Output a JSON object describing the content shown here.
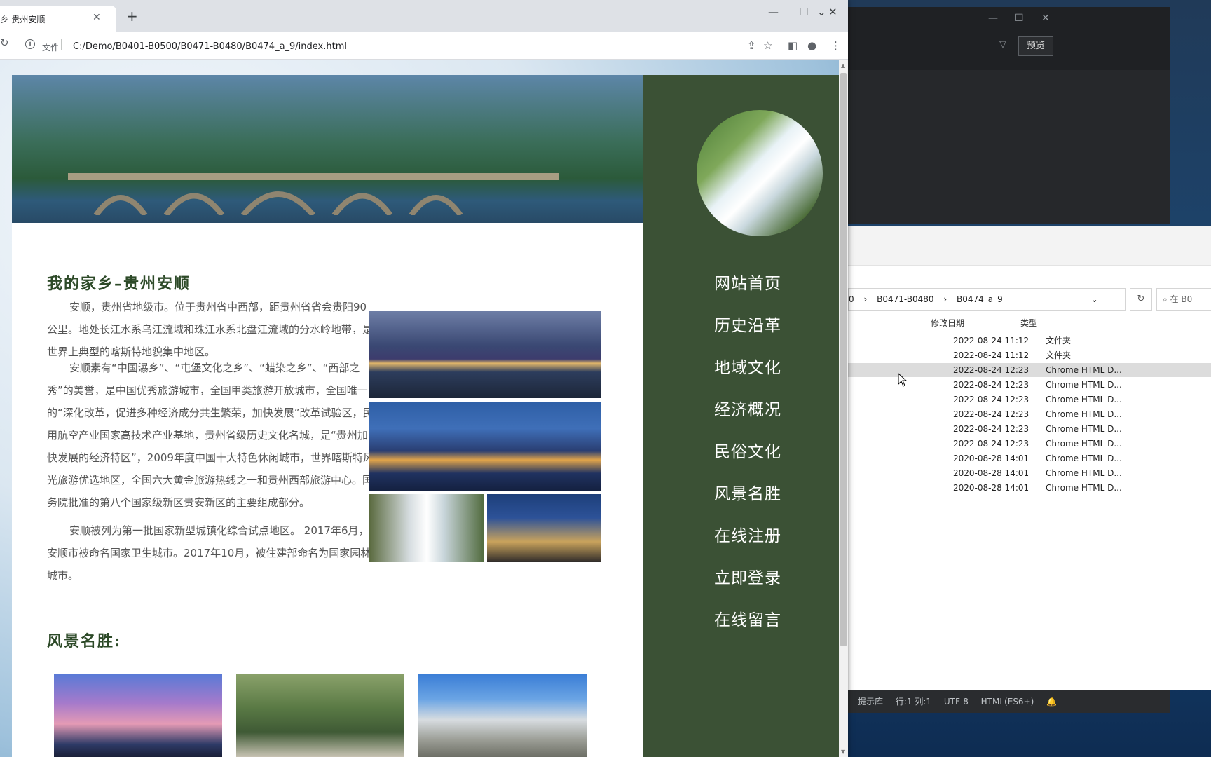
{
  "browser": {
    "tab_title": "乡-贵州安顺",
    "url_scheme_label": "文件",
    "url": "C:/Demo/B0401-B0500/B0471-B0480/B0474_a_9/index.html"
  },
  "page": {
    "title": "我的家乡–贵州安顺",
    "paragraphs": [
      "安顺，贵州省地级市。位于贵州省中西部，距贵州省省会贵阳90公里。地处长江水系乌江流域和珠江水系北盘江流域的分水岭地带，是世界上典型的喀斯特地貌集中地区。",
      "安顺素有“中国瀑乡”、“屯堡文化之乡”、“蜡染之乡”、“西部之秀”的美誉，是中国优秀旅游城市，全国甲类旅游开放城市，全国唯一的“深化改革，促进多种经济成分共生繁荣，加快发展”改革试验区，民用航空产业国家高技术产业基地，贵州省级历史文化名城，是“贵州加快发展的经济特区”，2009年度中国十大特色休闲城市，世界喀斯特风光旅游优选地区，全国六大黄金旅游热线之一和贵州西部旅游中心。国务院批准的第八个国家级新区贵安新区的主要组成部分。",
      "安顺被列为第一批国家新型城镇化综合试点地区。 2017年6月，安顺市被命名国家卫生城市。2017年10月，被住建部命名为国家园林城市。"
    ],
    "subtitle": "风景名胜:",
    "nav": [
      "网站首页",
      "历史沿革",
      "地域文化",
      "经济概况",
      "民俗文化",
      "风景名胜",
      "在线注册",
      "立即登录",
      "在线留言"
    ]
  },
  "editor": {
    "preview_label": "预览",
    "status": [
      "提示库",
      "行:1 列:1",
      "UTF-8",
      "HTML(ES6+)"
    ]
  },
  "explorer": {
    "breadcrumb": [
      "0",
      "B0471-B0480",
      "B0474_a_9"
    ],
    "search_placeholder": "在 B0",
    "columns": [
      "修改日期",
      "类型"
    ],
    "rows": [
      {
        "date": "2022-08-24 11:12",
        "type": "文件夹"
      },
      {
        "date": "2022-08-24 11:12",
        "type": "文件夹"
      },
      {
        "date": "2022-08-24 12:23",
        "type": "Chrome HTML D..."
      },
      {
        "date": "2022-08-24 12:23",
        "type": "Chrome HTML D..."
      },
      {
        "date": "2022-08-24 12:23",
        "type": "Chrome HTML D..."
      },
      {
        "date": "2022-08-24 12:23",
        "type": "Chrome HTML D..."
      },
      {
        "date": "2022-08-24 12:23",
        "type": "Chrome HTML D..."
      },
      {
        "date": "2022-08-24 12:23",
        "type": "Chrome HTML D..."
      },
      {
        "date": "2020-08-28 14:01",
        "type": "Chrome HTML D..."
      },
      {
        "date": "2020-08-28 14:01",
        "type": "Chrome HTML D..."
      },
      {
        "date": "2020-08-28 14:01",
        "type": "Chrome HTML D..."
      }
    ]
  }
}
